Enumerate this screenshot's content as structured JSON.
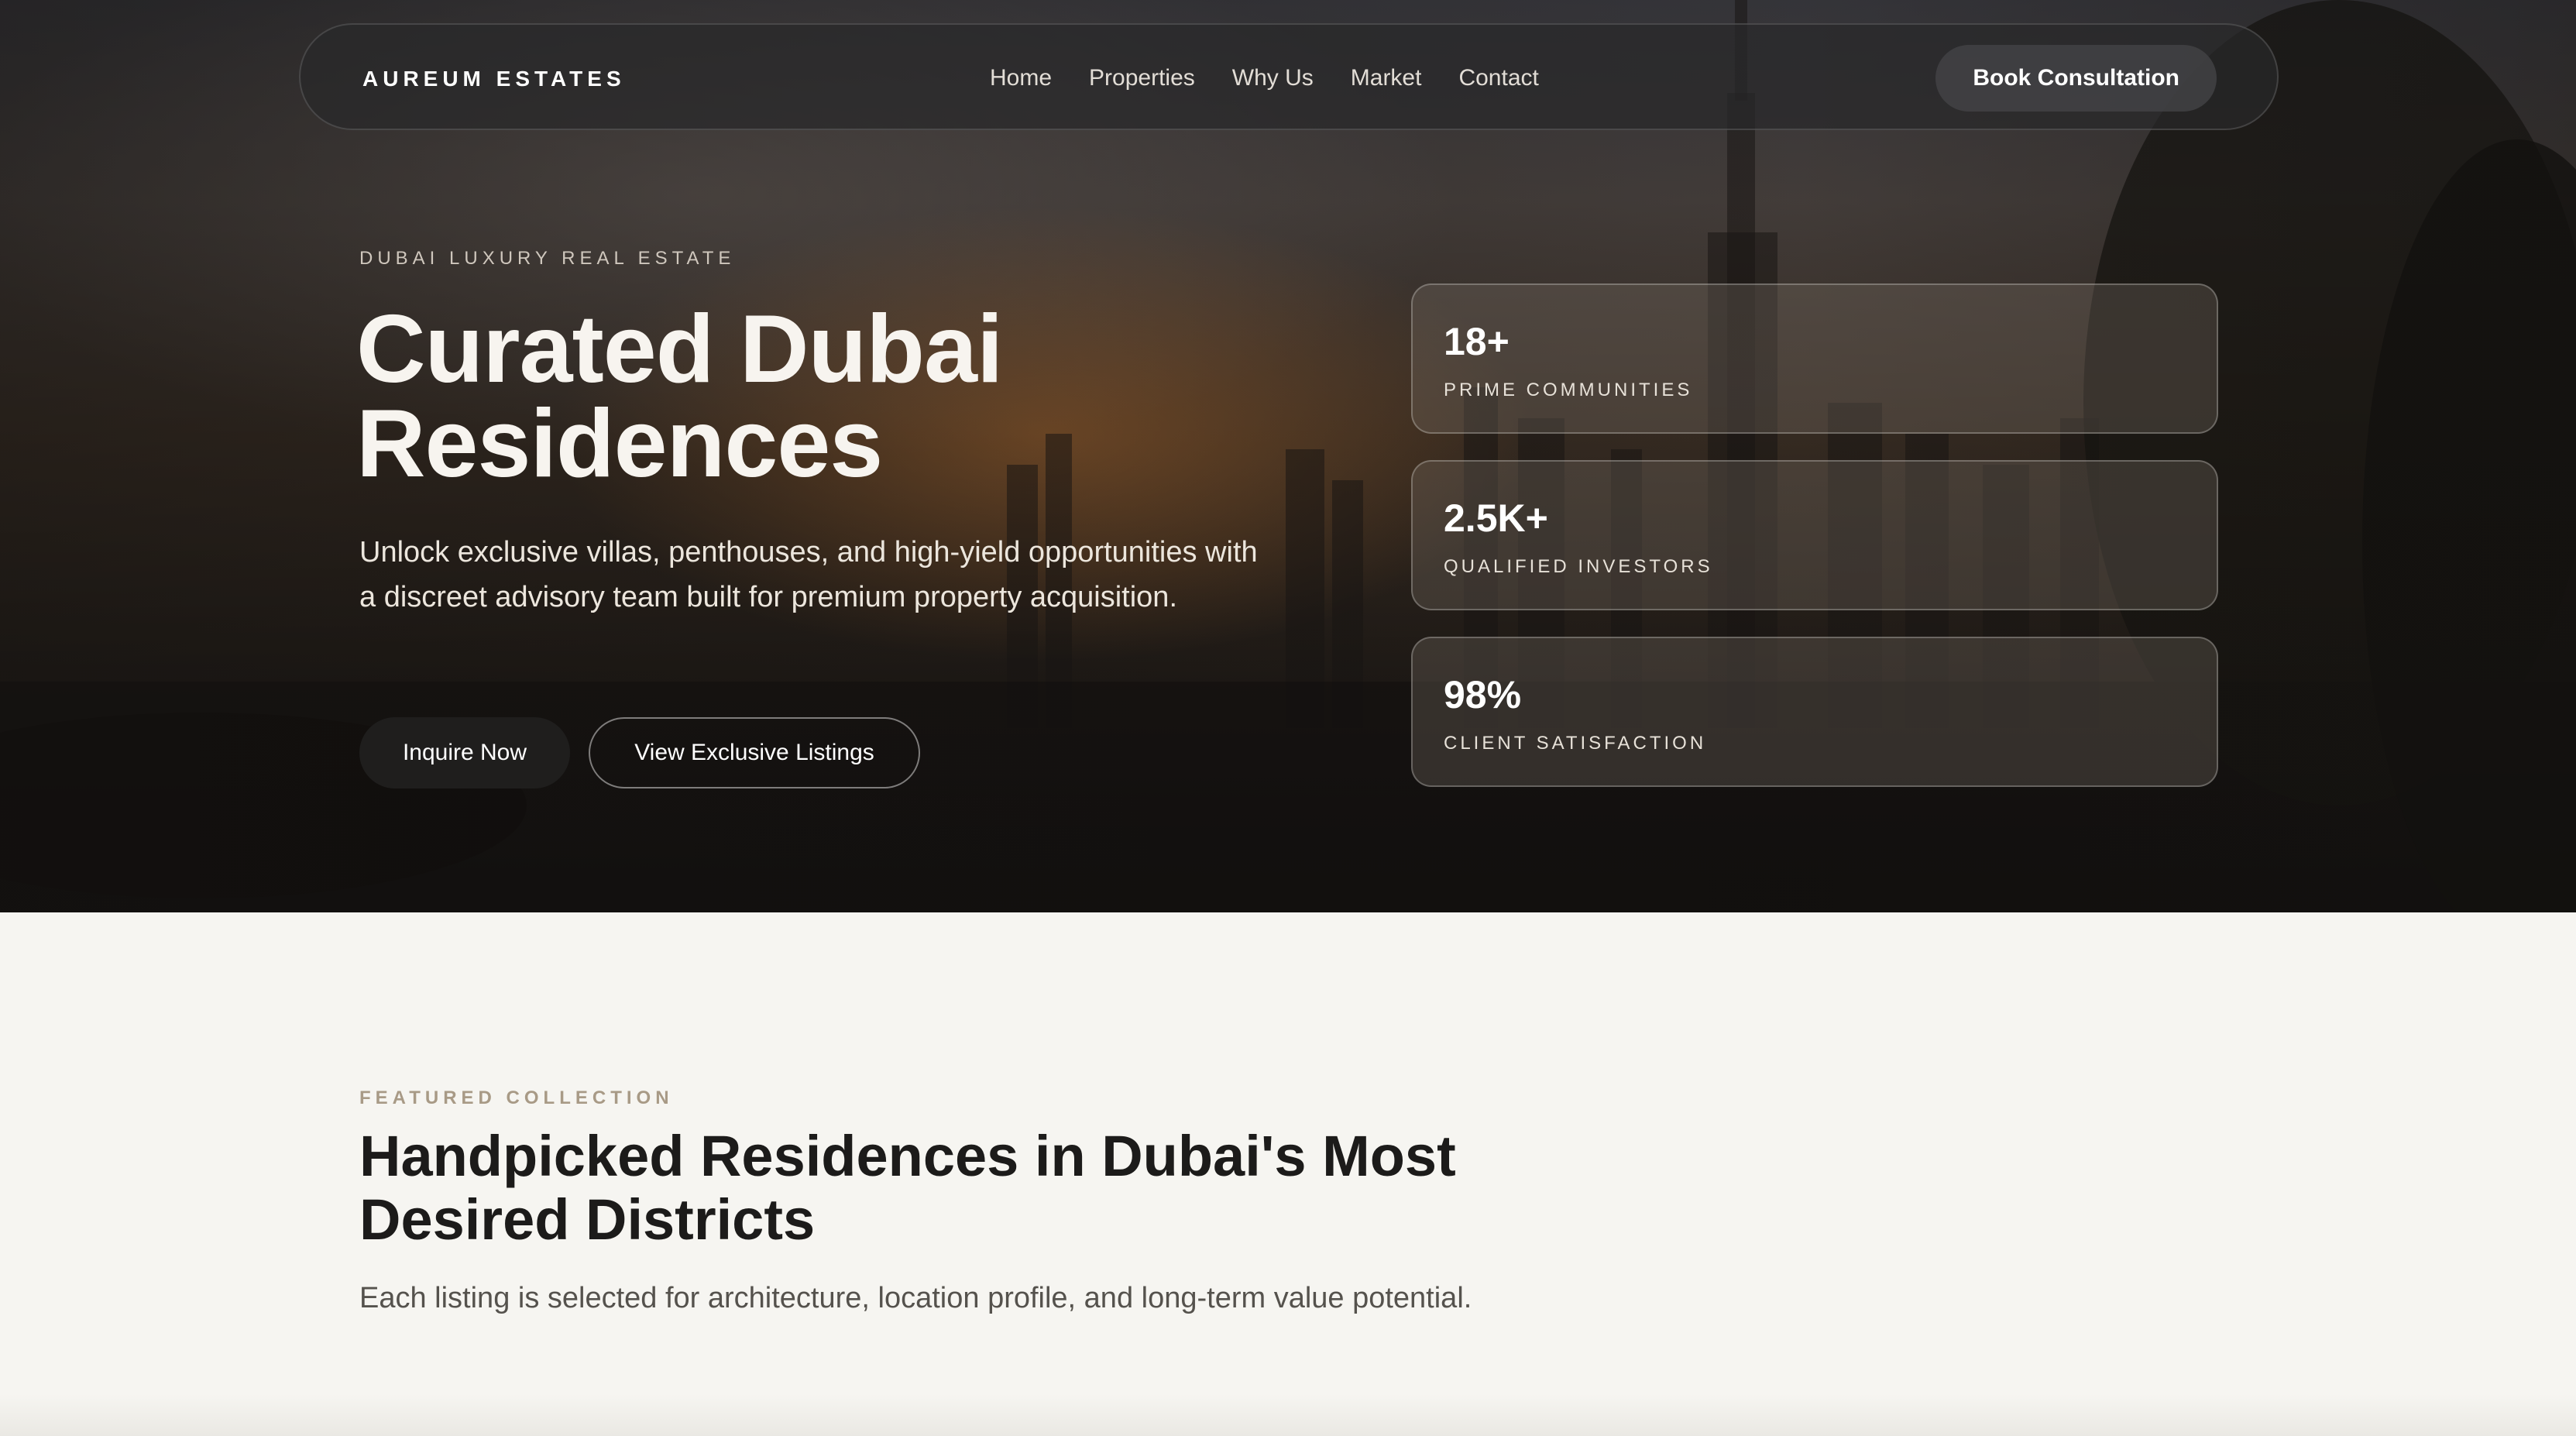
{
  "nav": {
    "brand": "AUREUM ESTATES",
    "links": [
      "Home",
      "Properties",
      "Why Us",
      "Market",
      "Contact"
    ],
    "cta": "Book Consultation"
  },
  "hero": {
    "eyebrow": "DUBAI LUXURY REAL ESTATE",
    "title_line1": "Curated Dubai",
    "title_line2": "Residences",
    "subtitle": "Unlock exclusive villas, penthouses, and high-yield opportunities with a discreet advisory team built for premium property acquisition.",
    "primary_button": "Inquire Now",
    "secondary_button": "View Exclusive Listings"
  },
  "stats": [
    {
      "value": "18+",
      "label": "PRIME COMMUNITIES"
    },
    {
      "value": "2.5K+",
      "label": "QUALIFIED INVESTORS"
    },
    {
      "value": "98%",
      "label": "CLIENT SATISFACTION"
    }
  ],
  "featured": {
    "eyebrow": "FEATURED COLLECTION",
    "title": "Handpicked Residences in Dubai's Most Desired Districts",
    "subtitle": "Each listing is selected for architecture, location profile, and long-term value potential."
  },
  "colors": {
    "page_bg": "#f6f5f1",
    "hero_dark": "#1f1e1d",
    "accent_muted": "#a89a86"
  }
}
